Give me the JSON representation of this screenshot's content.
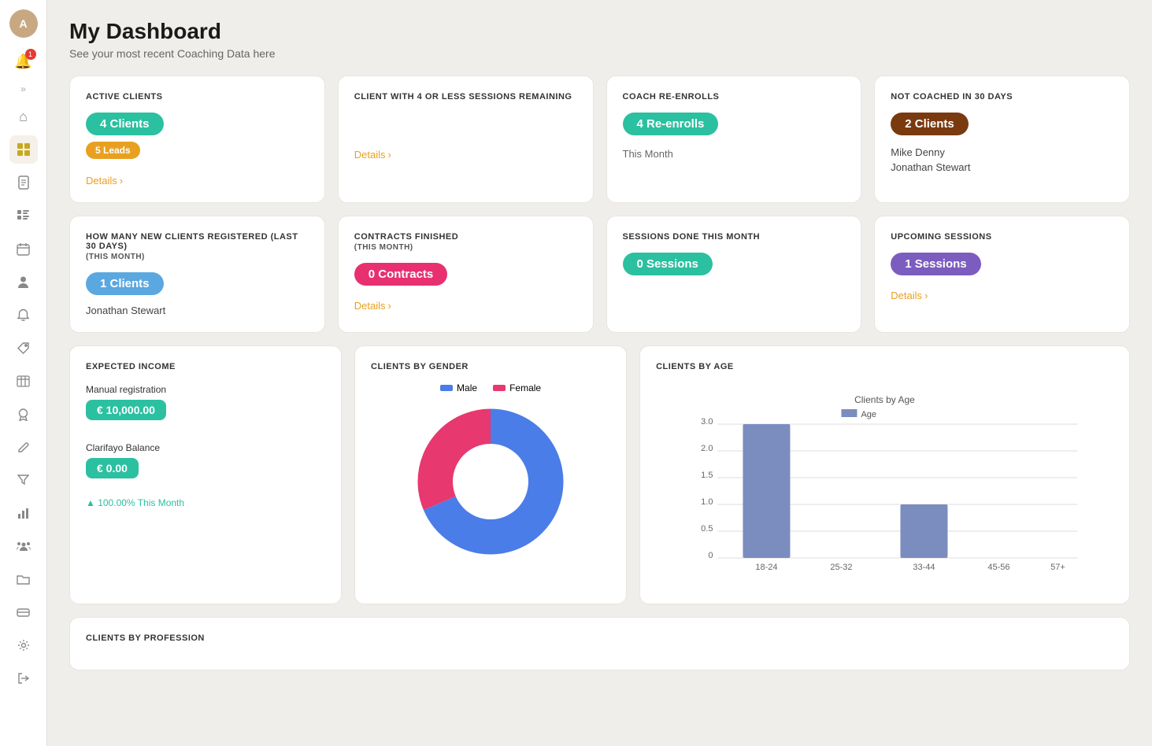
{
  "page": {
    "title": "My Dashboard",
    "subtitle": "See your most recent Coaching Data here"
  },
  "sidebar": {
    "avatar_initials": "A",
    "notification_count": "1",
    "expand_label": "»",
    "icons": [
      {
        "name": "home-icon",
        "symbol": "⌂",
        "active": false
      },
      {
        "name": "dashboard-icon",
        "symbol": "⊞",
        "active": true
      },
      {
        "name": "document-icon",
        "symbol": "📄",
        "active": false
      },
      {
        "name": "grid-icon",
        "symbol": "▦",
        "active": false
      },
      {
        "name": "calendar-icon",
        "symbol": "📅",
        "active": false
      },
      {
        "name": "person-icon",
        "symbol": "👤",
        "active": false
      },
      {
        "name": "bell-icon",
        "symbol": "🔔",
        "active": false
      },
      {
        "name": "tag-icon",
        "symbol": "🏷",
        "active": false
      },
      {
        "name": "list-icon",
        "symbol": "☰",
        "active": false
      },
      {
        "name": "star-icon",
        "symbol": "✦",
        "active": false
      },
      {
        "name": "pen-icon",
        "symbol": "✏",
        "active": false
      },
      {
        "name": "filter-icon",
        "symbol": "⧖",
        "active": false
      },
      {
        "name": "chart-icon",
        "symbol": "📊",
        "active": false
      },
      {
        "name": "group-icon",
        "symbol": "👥",
        "active": false
      },
      {
        "name": "folder-icon",
        "symbol": "📁",
        "active": false
      },
      {
        "name": "card-icon",
        "symbol": "💳",
        "active": false
      },
      {
        "name": "settings-icon",
        "symbol": "⚙",
        "active": false
      },
      {
        "name": "logout-icon",
        "symbol": "→",
        "active": false
      }
    ]
  },
  "cards": {
    "active_clients": {
      "label": "ACTIVE CLIENTS",
      "badge": "4 Clients",
      "sub_badge": "5 Leads",
      "details_label": "Details"
    },
    "less_sessions": {
      "label": "CLIENT WITH 4 OR LESS SESSIONS REMAINING",
      "details_label": "Details"
    },
    "coach_reenrolls": {
      "label": "COACH RE-ENROLLS",
      "badge": "4 Re-enrolls",
      "this_month": "This Month"
    },
    "not_coached": {
      "label": "NOT COACHED IN 30 DAYS",
      "badge": "2 Clients",
      "clients": [
        "Mike Denny",
        "Jonathan Stewart"
      ]
    },
    "new_clients": {
      "label": "HOW MANY NEW CLIENTS REGISTERED (LAST 30 DAYS)",
      "sub_label": "(THIS MONTH)",
      "badge": "1 Clients",
      "client_name": "Jonathan Stewart"
    },
    "contracts": {
      "label": "CONTRACTS FINISHED",
      "sub_label": "(THIS MONTH)",
      "badge": "0 Contracts",
      "details_label": "Details"
    },
    "sessions_done": {
      "label": "SESSIONS DONE THIS MONTH",
      "badge": "0 Sessions"
    },
    "upcoming_sessions": {
      "label": "UPCOMING SESSIONS",
      "badge": "1 Sessions",
      "details_label": "Details"
    }
  },
  "income": {
    "label": "EXPECTED INCOME",
    "manual_label": "Manual registration",
    "manual_value": "€ 10,000.00",
    "balance_label": "Clarifayo Balance",
    "balance_value": "€ 0.00",
    "percent": "▲ 100.00%  This Month"
  },
  "gender_chart": {
    "label": "CLIENTS BY GENDER",
    "legend_male": "Male",
    "legend_female": "Female",
    "male_pct": 68,
    "female_pct": 32
  },
  "age_chart": {
    "label": "CLIENTS BY AGE",
    "chart_title": "Clients by Age",
    "legend_label": "Age",
    "bars": [
      {
        "range": "18-24",
        "value": 3
      },
      {
        "range": "25-32",
        "value": 0
      },
      {
        "range": "33-44",
        "value": 1
      },
      {
        "range": "45-56",
        "value": 0
      },
      {
        "range": "57+",
        "value": 0
      }
    ],
    "y_max": 3
  },
  "profession": {
    "label": "CLIENTS BY PROFESSION"
  }
}
